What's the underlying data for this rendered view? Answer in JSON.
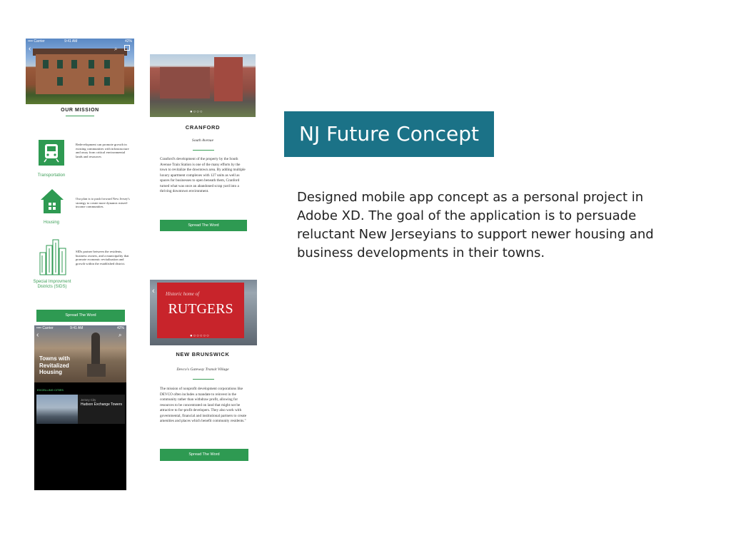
{
  "slide": {
    "title": "NJ Future Concept",
    "description": "Designed mobile app concept as a  personal project in Adobe XD. The goal of the application is to persuade reluctant New Jerseyians to support newer housing and business developments in their towns."
  },
  "colors": {
    "title_bg": "#1b7287",
    "accent_green": "#2e9a52"
  },
  "mission_screen": {
    "status_carrier": "•••• Carrier",
    "status_time": "9:41 AM",
    "status_battery": "42%",
    "title": "OUR MISSION",
    "features": [
      {
        "icon": "train-icon",
        "label": "Transportation",
        "text": "Redevelopment can promote growth in existing communities with infrastructure and away from critical environmental lands and resources"
      },
      {
        "icon": "house-icon",
        "label": "Housing",
        "text": "Our plan is to push forward New Jersey's strategy to create more dynamic mixed-income communities."
      },
      {
        "icon": "city-icon",
        "label": "Special Improvment Districts (SIDS)",
        "text": "SIDs partner between the residents, business owners, and a municipality that promote economic revitalization and growth within the established district."
      }
    ],
    "button": "Spread The Word"
  },
  "towns_screen": {
    "status_carrier": "•••• Carrier",
    "status_time": "9:41 AM",
    "status_battery": "42%",
    "title": "Towns with Revitalized Housing",
    "section_label": "EXCELLING CITIES",
    "card_sub": "Jersey City",
    "card_title": "Hudson Exchange Towers"
  },
  "cranford_screen": {
    "city": "CRANFORD",
    "subtitle": "South Avenue",
    "body": "Cranford's development of the property by the South Avenue Train Station is one of the many efforts by the town to revitalize the downtown area. By adding multiple luxury apartment complexes with 127 units as well as spaces for businesses to open beneath them, Cranford turned what was once an abandoned scrap yard into a thriving downtown environment.",
    "button": "Spread The Word"
  },
  "brunswick_screen": {
    "banner_small": "Historic home of",
    "banner_big": "RUTGERS",
    "city": "NEW BRUNSWICK",
    "subtitle": "Devco's Gateway Transit Village",
    "body": "The mission of nonprofit development corporations like DEVCO often includes a mandate to reinvest in the community rather than withdraw profit, allowing for resources to be concentrated on land that might not be attractive to for-profit developers. They also work with governmental, financial and institutional partners to create amenities and places which benefit community residents.\"",
    "button": "Spread The Word"
  }
}
